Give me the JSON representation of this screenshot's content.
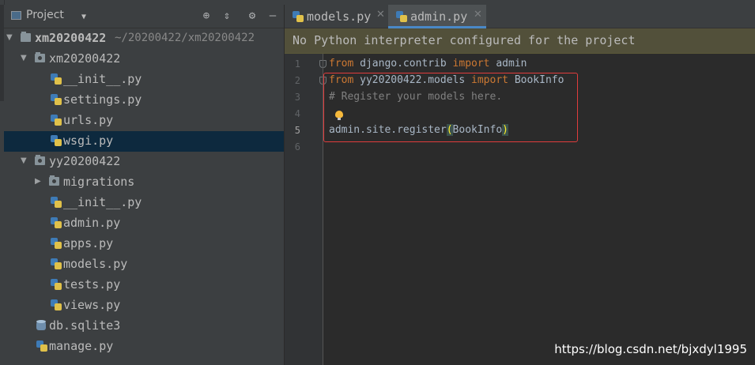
{
  "project_panel": {
    "title": "Project",
    "tree": [
      {
        "label": "xm20200422",
        "path": "~/20200422/xm20200422"
      },
      {
        "label": "xm20200422"
      },
      {
        "label": "__init__.py"
      },
      {
        "label": "settings.py"
      },
      {
        "label": "urls.py"
      },
      {
        "label": "wsgi.py",
        "selected": true
      },
      {
        "label": "yy20200422"
      },
      {
        "label": "migrations"
      },
      {
        "label": "__init__.py"
      },
      {
        "label": "admin.py"
      },
      {
        "label": "apps.py"
      },
      {
        "label": "models.py"
      },
      {
        "label": "tests.py"
      },
      {
        "label": "views.py"
      },
      {
        "label": "db.sqlite3"
      },
      {
        "label": "manage.py"
      }
    ]
  },
  "editor": {
    "tabs": [
      {
        "label": "models.py",
        "active": false
      },
      {
        "label": "admin.py",
        "active": true
      }
    ],
    "banner": "No Python interpreter configured for the project",
    "line_numbers": [
      "1",
      "2",
      "3",
      "4",
      "5",
      "6"
    ],
    "lines": {
      "l1": {
        "kw1": "from",
        "t1": " django.contrib ",
        "kw2": "import",
        "t2": " admin"
      },
      "l2": {
        "kw1": "from",
        "t1": " yy20200422.models ",
        "kw2": "import",
        "t2": " BookInfo"
      },
      "l3": {
        "comment": "# Register your models here."
      },
      "l5": {
        "t1": "admin.site.register",
        "p1": "(",
        "t2": "BookInfo",
        "p2": ")"
      }
    }
  },
  "watermark": "https://blog.csdn.net/bjxdyl1995",
  "colors": {
    "keyword": "#cc7832",
    "comment": "#808080",
    "highlight_box": "#e03d3d",
    "banner_bg": "#52503a"
  }
}
